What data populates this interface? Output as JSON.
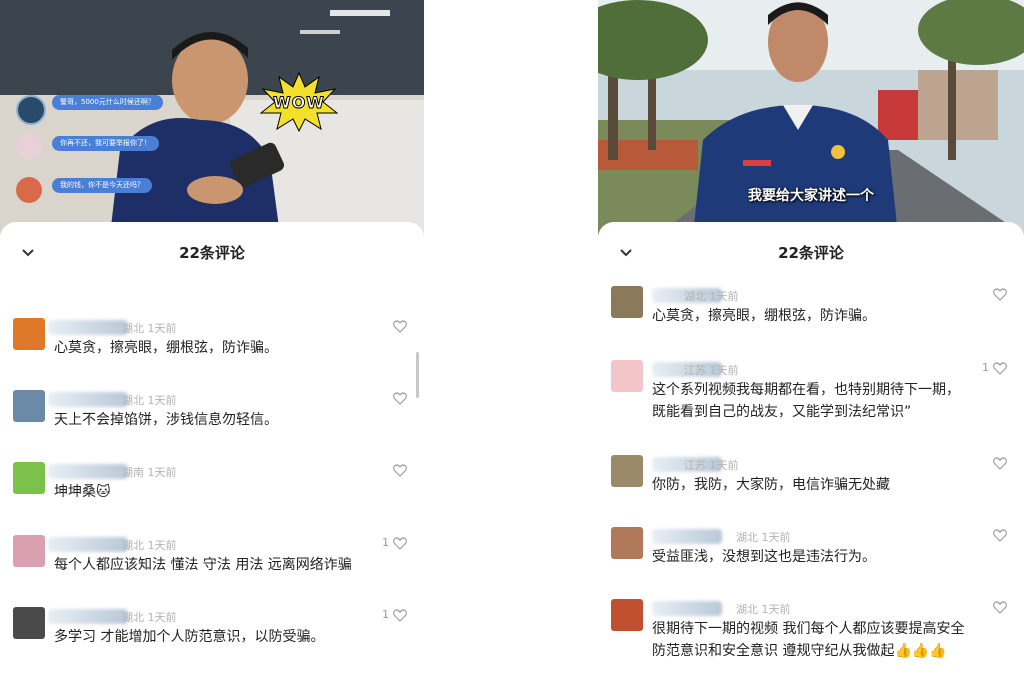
{
  "left": {
    "video": {
      "wow_sticker": "WOW",
      "chat_bubbles": [
        {
          "text": "警哥，5000元什么时候还啊？"
        },
        {
          "text": "你再不还，我可要举报你了！"
        },
        {
          "text": "我的钱，你不是今天还吗？"
        }
      ]
    },
    "header": {
      "count_label": "22条评论"
    },
    "comments": [
      {
        "meta": "湖北 1天前",
        "text": "心莫贪，擦亮眼，绷根弦，防诈骗。",
        "likes": "",
        "avatar_color": "#e0782a"
      },
      {
        "meta": "湖北 1天前",
        "text": "天上不会掉馅饼，涉钱信息勿轻信。",
        "likes": "",
        "avatar_color": "#6a8aa8"
      },
      {
        "meta": "湖南 1天前",
        "text": "坤坤桑",
        "emoji": "🐱",
        "likes": "",
        "avatar_color": "#7cc24a"
      },
      {
        "meta": "湖北 1天前",
        "text": "每个人都应该知法 懂法 守法 用法 远离网络诈骗",
        "likes": "1",
        "avatar_color": "#d9a0b0"
      },
      {
        "meta": "湖北 1天前",
        "text": "多学习 才能增加个人防范意识，以防受骗。",
        "likes": "1",
        "avatar_color": "#4a4a4a"
      }
    ]
  },
  "right": {
    "video": {
      "caption": "我要给大家讲述一个"
    },
    "header": {
      "count_label": "22条评论"
    },
    "comments": [
      {
        "meta": "湖北 1天前",
        "text": "心莫贪，擦亮眼，绷根弦，防诈骗。",
        "likes": "",
        "avatar_color": "#8a7a5a"
      },
      {
        "meta": "江苏 1天前",
        "lines": [
          "这个系列视频我每期都在看，也特别期待下一期，",
          "既能看到自己的战友，又能学到法纪常识”"
        ],
        "likes": "1",
        "avatar_color": "#f2c6c8"
      },
      {
        "meta": "江苏 1天前",
        "text": "你防，我防，大家防，电信诈骗无处藏",
        "likes": "",
        "avatar_color": "#9a8a6a"
      },
      {
        "meta": "湖北 1天前",
        "text": "受益匪浅，没想到这也是违法行为。",
        "likes": "",
        "avatar_color": "#b07a5a"
      },
      {
        "meta": "湖北 1天前",
        "lines": [
          "很期待下一期的视频 我们每个人都应该要提高安全",
          "防范意识和安全意识  遵规守纪从我做起"
        ],
        "emoji": "👍👍👍",
        "likes": "",
        "avatar_color": "#c05030"
      }
    ]
  },
  "colors": {
    "meta_gray": "#b3b3b3",
    "text_dark": "#222222",
    "chat_blue": "#4a7fd6"
  }
}
